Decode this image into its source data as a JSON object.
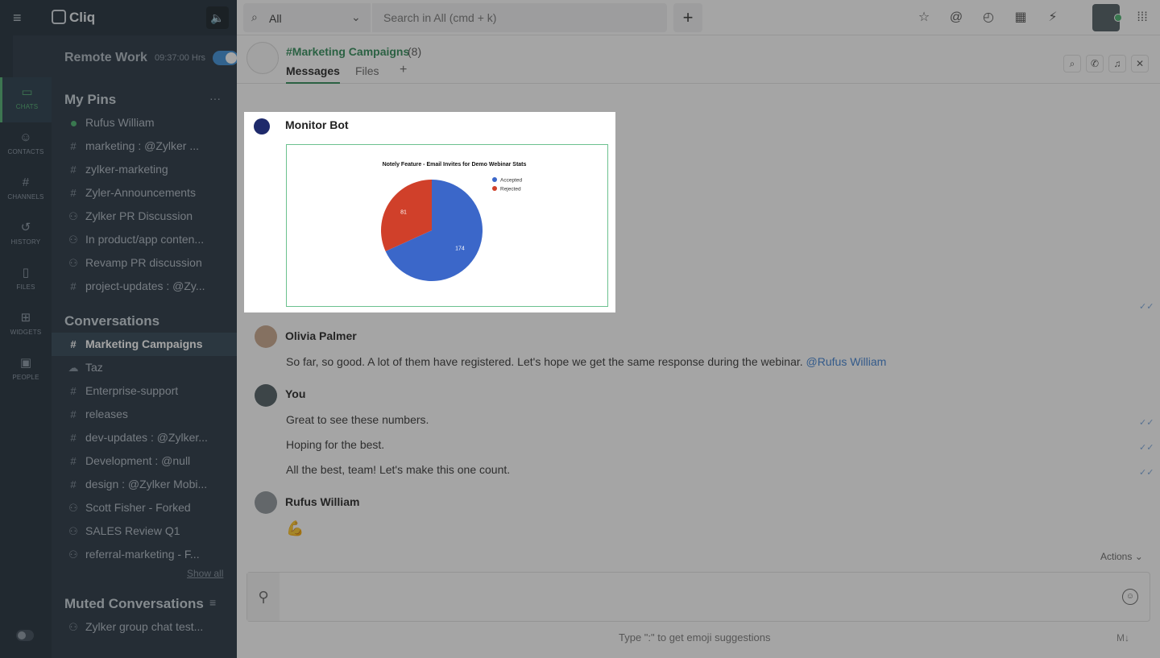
{
  "app": {
    "name": "Cliq"
  },
  "workspace": {
    "name": "Remote Work",
    "timer": "09:37:00 Hrs"
  },
  "rail": [
    {
      "label": "CHATS",
      "icon": "chat-icon"
    },
    {
      "label": "CONTACTS",
      "icon": "contacts-icon"
    },
    {
      "label": "CHANNELS",
      "icon": "hash-icon"
    },
    {
      "label": "HISTORY",
      "icon": "history-icon"
    },
    {
      "label": "FILES",
      "icon": "file-icon"
    },
    {
      "label": "WIDGETS",
      "icon": "widgets-icon"
    },
    {
      "label": "PEOPLE",
      "icon": "people-icon"
    }
  ],
  "sidebar": {
    "pins_title": "My Pins",
    "pins": [
      {
        "prefix": "dot",
        "label": "Rufus William"
      },
      {
        "prefix": "#",
        "label": "marketing : @Zylker ..."
      },
      {
        "prefix": "#",
        "label": "zylker-marketing"
      },
      {
        "prefix": "#",
        "label": "Zyler-Announcements"
      },
      {
        "prefix": "group",
        "label": "Zylker PR Discussion"
      },
      {
        "prefix": "group",
        "label": "In product/app conten..."
      },
      {
        "prefix": "group",
        "label": "Revamp PR discussion"
      },
      {
        "prefix": "#",
        "label": "project-updates : @Zy..."
      }
    ],
    "conversations_title": "Conversations",
    "conversations": [
      {
        "prefix": "#",
        "label": "Marketing Campaigns"
      },
      {
        "prefix": "cloud",
        "label": "Taz"
      },
      {
        "prefix": "#",
        "label": "Enterprise-support"
      },
      {
        "prefix": "#",
        "label": "releases"
      },
      {
        "prefix": "#",
        "label": "dev-updates : @Zylker..."
      },
      {
        "prefix": "#",
        "label": "Development : @null"
      },
      {
        "prefix": "#",
        "label": "design : @Zylker Mobi..."
      },
      {
        "prefix": "group",
        "label": "Scott Fisher - Forked"
      },
      {
        "prefix": "group",
        "label": "SALES Review Q1"
      },
      {
        "prefix": "group",
        "label": "referral-marketing - F..."
      }
    ],
    "show_all": "Show all",
    "muted_title": "Muted Conversations",
    "muted": [
      {
        "prefix": "group",
        "label": "Zylker group chat test..."
      }
    ]
  },
  "search": {
    "scope": "All",
    "placeholder": "Search in All (cmd + k)"
  },
  "chat": {
    "title": "#Marketing Campaigns",
    "count": "(8)",
    "tabs": [
      "Messages",
      "Files"
    ],
    "add_tab": "+"
  },
  "messages": [
    {
      "sender": "Monitor Bot",
      "type": "chart"
    },
    {
      "sender": "Olivia Palmer",
      "text": "So far, so good. A lot of them have registered. Let's hope we get the same response during the webinar. ",
      "mention": "@Rufus William"
    },
    {
      "sender": "You",
      "lines": [
        "Great to see these numbers.",
        "Hoping for the best.",
        "All the best, team! Let's make this one count."
      ]
    },
    {
      "sender": "Rufus William",
      "text": "💪"
    }
  ],
  "actions_label": "Actions",
  "composer": {
    "hint": "Type \":\" to get emoji suggestions",
    "md": "M↓"
  },
  "chart_data": {
    "type": "pie",
    "title": "Notely Feature - Email Invites for Demo Webinar Stats",
    "labels": [
      "Accepted",
      "Rejected"
    ],
    "values": [
      174,
      81
    ],
    "colors": [
      "#3b67c9",
      "#d0402a"
    ],
    "legend": "top-right"
  }
}
